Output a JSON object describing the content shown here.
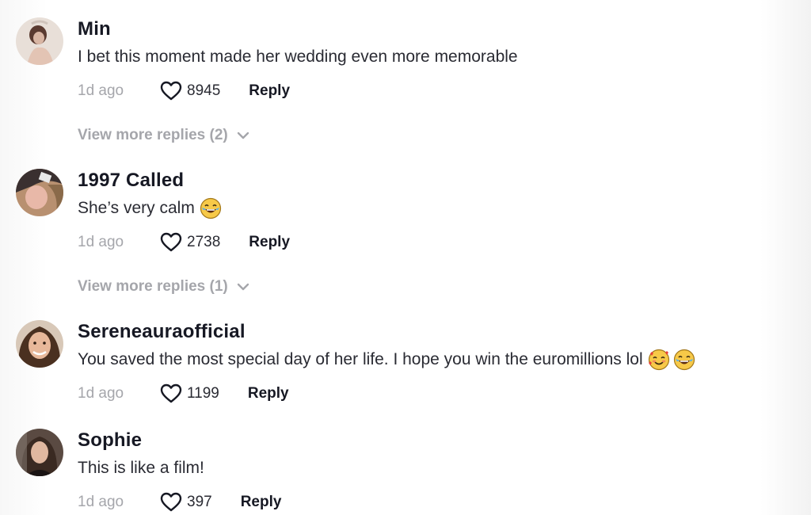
{
  "comments": [
    {
      "username": "Min",
      "text": "I bet this moment made her wedding even more memorable",
      "emojis": [],
      "time": "1d ago",
      "likes": "8945",
      "reply_label": "Reply",
      "view_more": "View more replies (2)"
    },
    {
      "username": "1997 Called",
      "text": "She’s very calm",
      "emojis": [
        "face-with-tears-of-joy"
      ],
      "time": "1d ago",
      "likes": "2738",
      "reply_label": "Reply",
      "view_more": "View more replies (1)"
    },
    {
      "username": "Sereneauraofficial",
      "text": "You saved the most special day of her life. I hope you win the euromillions lol",
      "emojis": [
        "smiling-face-with-hearts",
        "face-with-tears-of-joy"
      ],
      "time": "1d ago",
      "likes": "1199",
      "reply_label": "Reply"
    },
    {
      "username": "Sophie",
      "text": "This is like a film!",
      "emojis": [],
      "time": "1d ago",
      "likes": "397",
      "reply_label": "Reply"
    }
  ],
  "colors": {
    "username": "#161823",
    "text": "#2a2b33",
    "muted": "#a5a6ab"
  }
}
